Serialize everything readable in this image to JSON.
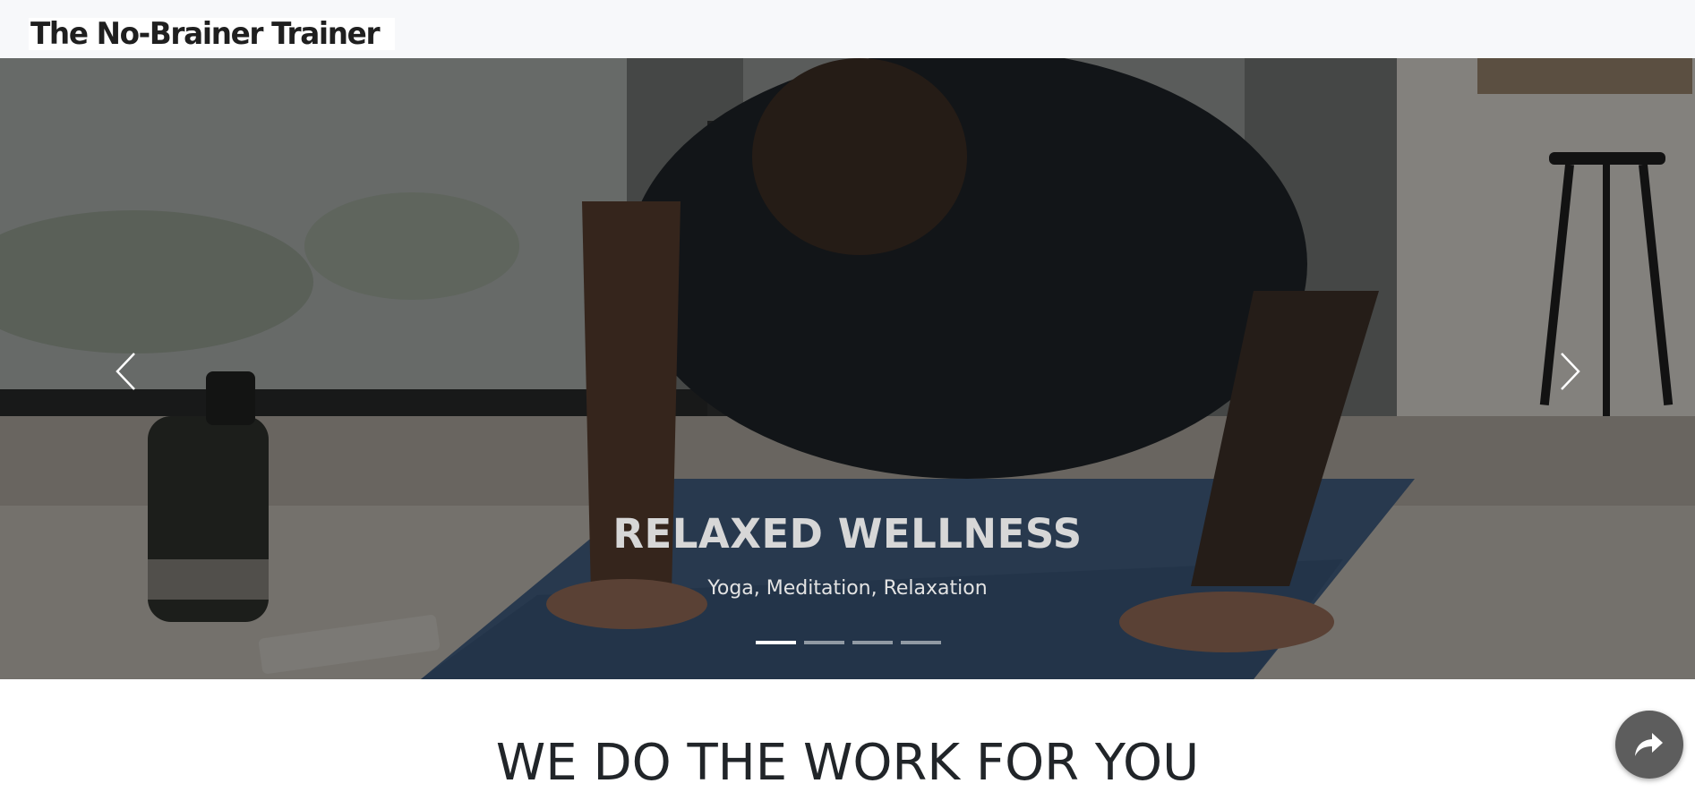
{
  "navbar": {
    "brand_text": "The No-Brainer Trainer"
  },
  "carousel": {
    "slides_count": 4,
    "active_index": 0,
    "caption_title": "RELAXED WELLNESS",
    "caption_subtitle": "Yoga, Meditation, Relaxation",
    "prev_icon": "chevron-left-icon",
    "next_icon": "chevron-right-icon"
  },
  "section": {
    "heading": "WE DO THE WORK FOR YOU"
  },
  "share_button": {
    "icon": "share-arrow-icon"
  },
  "colors": {
    "navbar_bg": "#f7f8fa",
    "heading_text": "#212529",
    "share_button_bg": "#5d5d5d",
    "indicator_active": "#ffffff"
  }
}
